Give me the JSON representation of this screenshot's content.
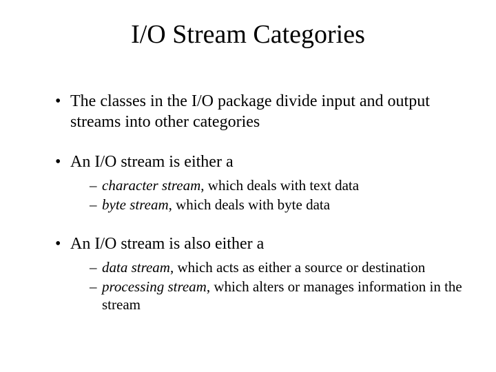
{
  "title": "I/O Stream Categories",
  "bullets": {
    "b1": "The classes in the I/O package divide input and output streams into other categories",
    "b2": "An I/O stream is either a",
    "b2_sub1_em": "character stream",
    "b2_sub1_rest": ", which deals with text data",
    "b2_sub2_em": "byte stream",
    "b2_sub2_rest": ", which deals with byte data",
    "b3": "An I/O stream is also either a",
    "b3_sub1_em": "data stream",
    "b3_sub1_rest": ", which acts as either a source or destination",
    "b3_sub2_em": "processing stream",
    "b3_sub2_rest": ", which alters or manages information in the stream"
  }
}
